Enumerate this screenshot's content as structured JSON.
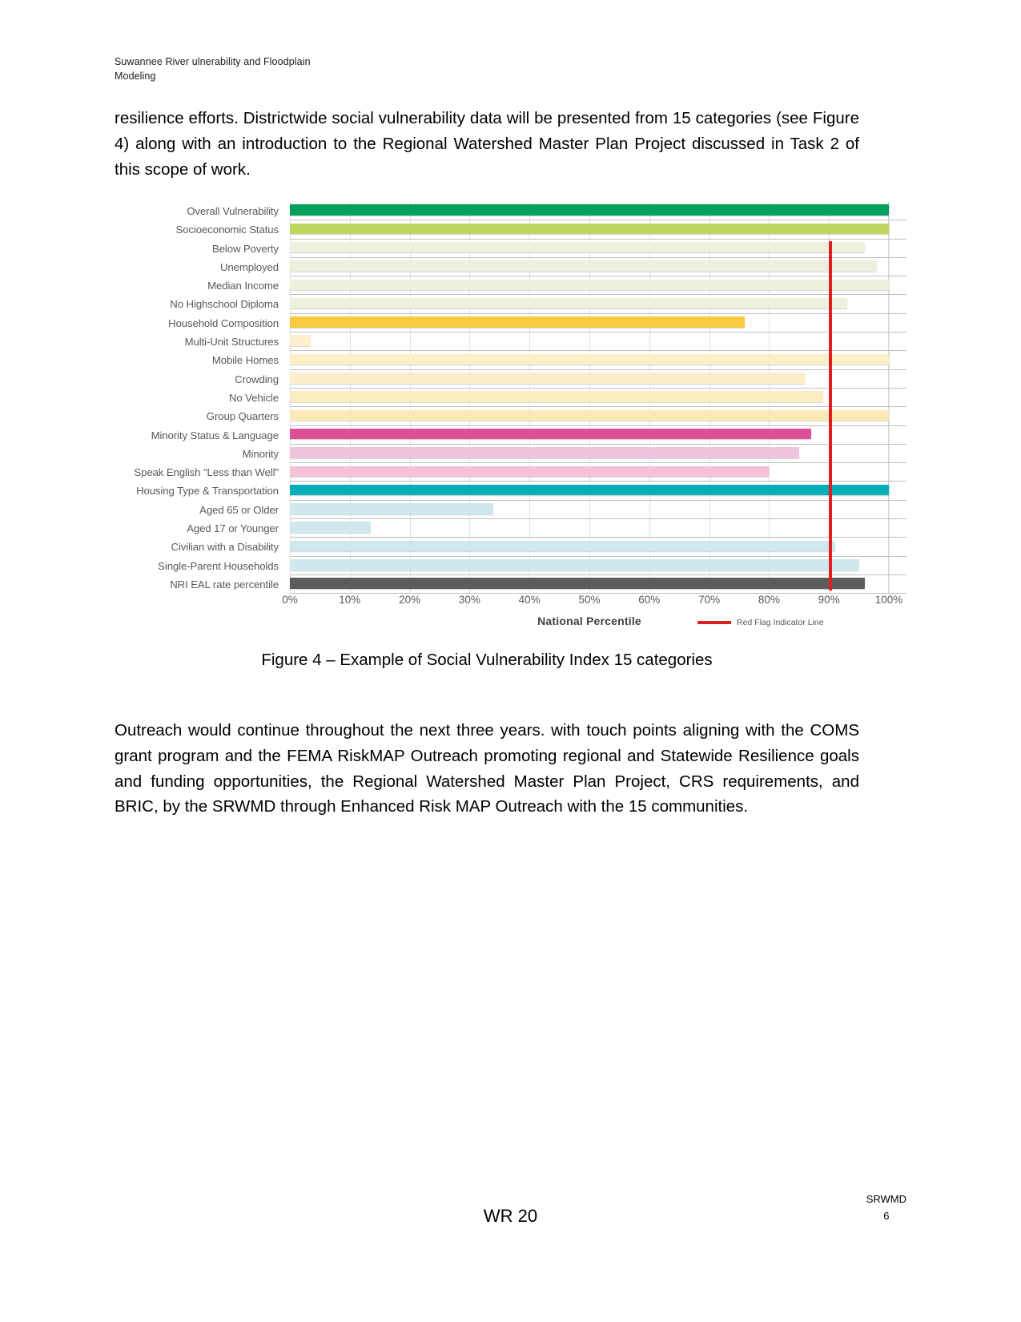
{
  "header": {
    "line1": "Suwannee River ulnerability and Floodplain",
    "line2": "Modeling"
  },
  "body": {
    "paragraph_1": "resilience efforts.  Districtwide social vulnerability data will be presented from 15 categories (see Figure 4) along with an introduction to the Regional Watershed Master Plan Project discussed in Task 2 of this scope of work.",
    "paragraph_2": "Outreach would continue throughout the next three years. with touch points aligning with the COMS grant program and the FEMA RiskMAP Outreach promoting regional and Statewide Resilience goals and funding opportunities, the Regional Watershed Master Plan Project, CRS requirements, and BRIC, by the SRWMD through Enhanced Risk MAP Outreach with the 15 communities."
  },
  "figure": {
    "caption": "Figure 4 – Example of Social Vulnerability Index 15 categories"
  },
  "footer": {
    "center": "WR 20",
    "right_org": "SRWMD",
    "right_page": "6"
  },
  "chart_data": {
    "type": "bar",
    "orientation": "horizontal",
    "title": "",
    "xlabel": "National Percentile",
    "ylabel": "",
    "xlim": [
      0,
      100
    ],
    "xticks": [
      "0%",
      "10%",
      "20%",
      "30%",
      "40%",
      "50%",
      "60%",
      "70%",
      "80%",
      "90%",
      "100%"
    ],
    "grid": true,
    "legend_position": "bottom-right",
    "legend": [
      {
        "label": "Red Flag Indicator Line",
        "color": "#e02020",
        "marker": "line"
      }
    ],
    "annotations": [
      {
        "name": "red-flag-indicator-line",
        "value": 90,
        "color": "#e02020"
      }
    ],
    "categories": [
      "Overall Vulnerability",
      "Socioeconomic Status",
      "Below Poverty",
      "Unemployed",
      "Median Income",
      "No Highschool Diploma",
      "Household Composition",
      "Multi-Unit Structures",
      "Mobile Homes",
      "Crowding",
      "No Vehicle",
      "Group Quarters",
      "Minority Status & Language",
      "Minority",
      "Speak English \"Less than Well\"",
      "Housing Type & Transportation",
      "Aged 65 or Older",
      "Aged 17 or Younger",
      "Civilian with a Disability",
      "Single-Parent Households",
      "NRI EAL rate percentile"
    ],
    "values": [
      100,
      100,
      96,
      98,
      100,
      93,
      76,
      3.5,
      100,
      86,
      89,
      100,
      87,
      85,
      80,
      100,
      34,
      13.5,
      91,
      95,
      96
    ],
    "colors": [
      "#00a05a",
      "#bcd65f",
      "#eef0dd",
      "#eef0dd",
      "#eef0dd",
      "#eef0dd",
      "#f7ca3f",
      "#fdf0cd",
      "#fdefc8",
      "#fdeecb",
      "#fcecc2",
      "#fbe9b8",
      "#dd4f96",
      "#f0c3dc",
      "#f5c1d6",
      "#00adb8",
      "#cfe8ee",
      "#cfe8ee",
      "#cfe8ee",
      "#cfe8ee",
      "#5c5c5c"
    ]
  }
}
